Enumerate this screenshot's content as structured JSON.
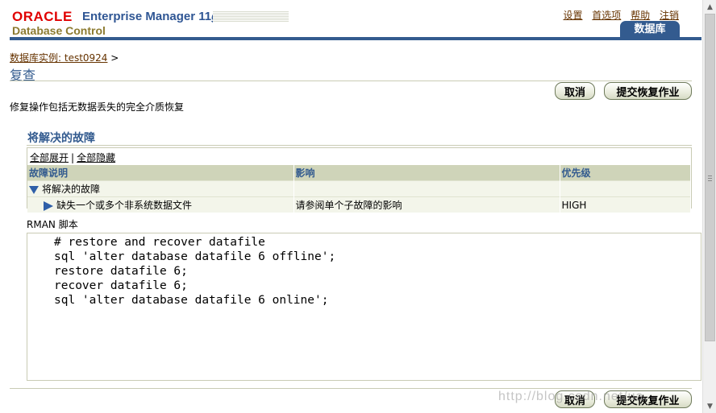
{
  "header": {
    "brand_oracle": "ORACLE",
    "brand_product": "Enterprise Manager",
    "brand_version": "11",
    "brand_version_suffix": "g",
    "brand_sub": "Database Control",
    "global_links": [
      "设置",
      "首选项",
      "帮助",
      "注销"
    ],
    "active_tab": "数据库"
  },
  "breadcrumb": {
    "link": "数据库实例: test0924",
    "separator": ">"
  },
  "page": {
    "title": "复查",
    "description": "修复操作包括无数据丢失的完全介质恢复"
  },
  "buttons": {
    "cancel": "取消",
    "submit": "提交恢复作业"
  },
  "issues": {
    "section_title": "将解决的故障",
    "expand_all": "全部展开",
    "link_separator": "|",
    "collapse_all": "全部隐藏",
    "columns": [
      "故障说明",
      "影响",
      "优先级"
    ],
    "group_row": {
      "description": "将解决的故障",
      "impact": "",
      "priority": ""
    },
    "rows": [
      {
        "description": "缺失一个或多个非系统数据文件",
        "impact": "请参阅单个子故障的影响",
        "priority": "HIGH"
      }
    ]
  },
  "rman": {
    "label": "RMAN 脚本",
    "script": "# restore and recover datafile\nsql 'alter database datafile 6 offline';\nrestore datafile 6;\nrecover datafile 6;\nsql 'alter database datafile 6 online';"
  },
  "watermark": "http://blog.csdn.net/ua",
  "colors": {
    "brand_red": "#e00000",
    "brand_blue": "#335b8f",
    "brand_gold": "#8c7a2f",
    "header_fill": "#cfd4b9",
    "link_brown": "#663300"
  },
  "icons": [
    "expand-down-icon",
    "collapse-right-icon",
    "scroll-up-icon",
    "scroll-down-icon"
  ]
}
